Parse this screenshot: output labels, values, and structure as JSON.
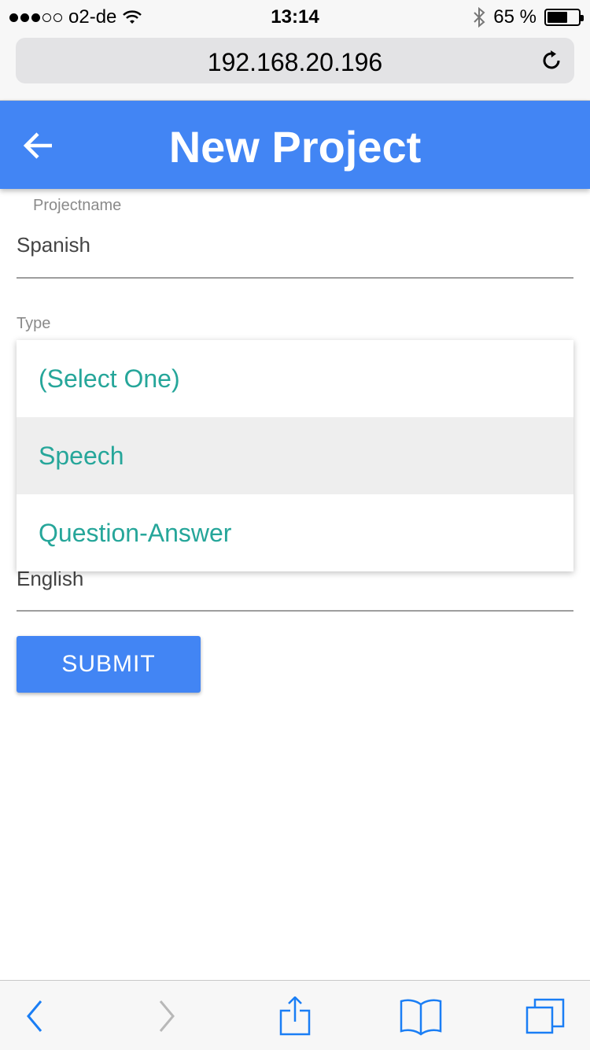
{
  "status_bar": {
    "carrier": "o2-de",
    "time": "13:14",
    "battery_text": "65 %",
    "battery_level": 0.65,
    "signal_bars_filled": 3,
    "signal_bars_total": 5
  },
  "browser": {
    "url": "192.168.20.196"
  },
  "app_bar": {
    "title": "New Project",
    "color": "#4285f4"
  },
  "form": {
    "projectname": {
      "label": "Projectname",
      "value": "Spanish"
    },
    "type": {
      "label": "Type",
      "options": [
        "(Select One)",
        "Speech",
        "Question-Answer"
      ],
      "highlighted_option": "Speech"
    },
    "language": {
      "value": "English"
    },
    "submit_label": "SUBMIT"
  },
  "colors": {
    "accent": "#4285f4",
    "option_text": "#26a69a"
  },
  "toolbar": {
    "icons": [
      "back-icon",
      "forward-icon",
      "share-icon",
      "bookmarks-icon",
      "tabs-icon"
    ]
  }
}
